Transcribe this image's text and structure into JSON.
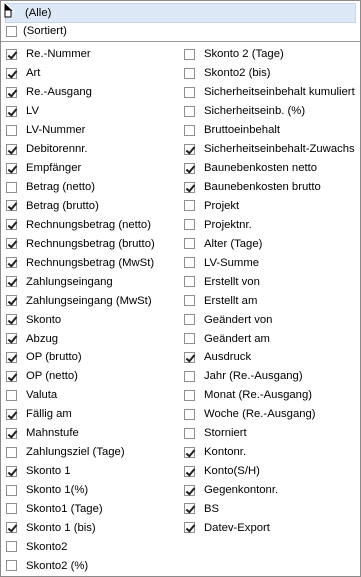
{
  "header": {
    "all_label": "(Alle)",
    "sorted_label": "(Sortiert)"
  },
  "left_items": [
    {
      "label": "Re.-Nummer",
      "checked": true
    },
    {
      "label": "Art",
      "checked": true
    },
    {
      "label": "Re.-Ausgang",
      "checked": true
    },
    {
      "label": "LV",
      "checked": true
    },
    {
      "label": "LV-Nummer",
      "checked": false
    },
    {
      "label": "Debitorennr.",
      "checked": true
    },
    {
      "label": "Empfänger",
      "checked": true
    },
    {
      "label": "Betrag (netto)",
      "checked": false
    },
    {
      "label": "Betrag (brutto)",
      "checked": true
    },
    {
      "label": "Rechnungsbetrag (netto)",
      "checked": true
    },
    {
      "label": "Rechnungsbetrag (brutto)",
      "checked": true
    },
    {
      "label": "Rechnungsbetrag (MwSt)",
      "checked": true
    },
    {
      "label": "Zahlungseingang",
      "checked": true
    },
    {
      "label": "Zahlungseingang (MwSt)",
      "checked": true
    },
    {
      "label": "Skonto",
      "checked": true
    },
    {
      "label": "Abzug",
      "checked": true
    },
    {
      "label": "OP (brutto)",
      "checked": true
    },
    {
      "label": "OP (netto)",
      "checked": true
    },
    {
      "label": "Valuta",
      "checked": false
    },
    {
      "label": "Fällig am",
      "checked": true
    },
    {
      "label": "Mahnstufe",
      "checked": true
    },
    {
      "label": "Zahlungsziel (Tage)",
      "checked": false
    },
    {
      "label": "Skonto 1",
      "checked": true
    },
    {
      "label": "Skonto 1(%)",
      "checked": false
    },
    {
      "label": "Skonto1 (Tage)",
      "checked": false
    },
    {
      "label": "Skonto 1 (bis)",
      "checked": true
    },
    {
      "label": "Skonto2",
      "checked": false
    },
    {
      "label": "Skonto2 (%)",
      "checked": false
    }
  ],
  "right_items": [
    {
      "label": "Skonto 2 (Tage)",
      "checked": false
    },
    {
      "label": "Skonto2 (bis)",
      "checked": false
    },
    {
      "label": "Sicherheitseinbehalt kumuliert",
      "checked": false
    },
    {
      "label": "Sicherheitseinb. (%)",
      "checked": false
    },
    {
      "label": "Bruttoeinbehalt",
      "checked": false
    },
    {
      "label": "Sicherheitseinbehalt-Zuwachs",
      "checked": true
    },
    {
      "label": "Baunebenkosten netto",
      "checked": true
    },
    {
      "label": "Baunebenkosten brutto",
      "checked": true
    },
    {
      "label": "Projekt",
      "checked": false
    },
    {
      "label": "Projektnr.",
      "checked": false
    },
    {
      "label": "Alter (Tage)",
      "checked": false
    },
    {
      "label": "LV-Summe",
      "checked": false
    },
    {
      "label": "Erstellt von",
      "checked": false
    },
    {
      "label": "Erstellt am",
      "checked": false
    },
    {
      "label": "Geändert von",
      "checked": false
    },
    {
      "label": "Geändert am",
      "checked": false
    },
    {
      "label": "Ausdruck",
      "checked": true
    },
    {
      "label": "Jahr (Re.-Ausgang)",
      "checked": false
    },
    {
      "label": "Monat (Re.-Ausgang)",
      "checked": false
    },
    {
      "label": " Woche (Re.-Ausgang)",
      "checked": false
    },
    {
      "label": "Storniert",
      "checked": false
    },
    {
      "label": "Kontonr.",
      "checked": true
    },
    {
      "label": "Konto(S/H)",
      "checked": true
    },
    {
      "label": "Gegenkontonr.",
      "checked": true
    },
    {
      "label": "BS",
      "checked": true
    },
    {
      "label": "Datev-Export",
      "checked": true
    }
  ]
}
